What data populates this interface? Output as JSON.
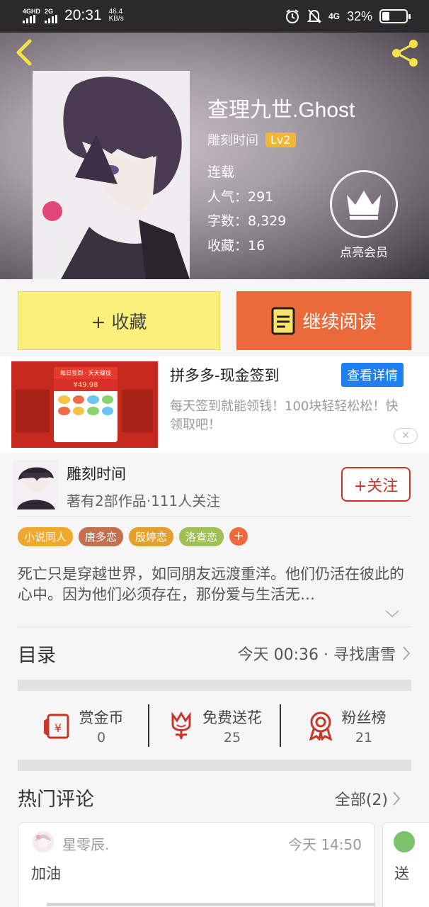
{
  "status_bar": {
    "net1": "4GHD",
    "net2": "2G",
    "time": "20:31",
    "speed_value": "46.4",
    "speed_unit": "KB/s",
    "net3": "4G",
    "battery_text": "32%",
    "battery_level": 0.32
  },
  "book": {
    "title": "查理九世.Ghost",
    "author": "雕刻时间",
    "level": "Lv2",
    "status": "连载",
    "popularity": "人气：291",
    "word_count": "字数：8,329",
    "favorites": "收藏：16"
  },
  "member": {
    "label": "点亮会员"
  },
  "actions": {
    "favorite": "+ 收藏",
    "continue_read": "继续阅读"
  },
  "ad": {
    "image_title": "每日签到 · 天天赚钱",
    "image_amount": "¥49.98",
    "title": "拼多多-现金签到",
    "cta": "查看详情",
    "description": "每天签到就能领钱！100块轻轻松松！快领取吧！",
    "close": "✕"
  },
  "author_card": {
    "name": "雕刻时间",
    "works": "著有2部作品·111人关注",
    "follow": "+关注"
  },
  "tags": [
    {
      "label": "小说同人",
      "color": "#f0a72d"
    },
    {
      "label": "唐多恋",
      "color": "#c4704f"
    },
    {
      "label": "殷婷恋",
      "color": "#e4a02f"
    },
    {
      "label": "洛查恋",
      "color": "#9fc053"
    }
  ],
  "tag_more": "+",
  "synopsis": "死亡只是穿越世界，如同朋友远渡重洋。他们仍活在彼此的心中。因为他们必须存在，那份爱与生活无…",
  "catalog": {
    "title": "目录",
    "latest": "今天 00:36 · 寻找唐雪"
  },
  "stats": [
    {
      "label": "赏金币",
      "value": "0"
    },
    {
      "label": "免费送花",
      "value": "25"
    },
    {
      "label": "粉丝榜",
      "value": "21"
    }
  ],
  "hot_comments": {
    "title": "热门评论",
    "all": "全部(2)",
    "items": [
      {
        "user": "星零辰.",
        "time": "今天 14:50",
        "text": "加油"
      },
      {
        "text": "送"
      }
    ]
  },
  "colors": {
    "accent": "#ec6a39",
    "favorite_bg": "#faf07b",
    "follow": "#c8362a",
    "level": "#f2b631",
    "ad_cta": "#1f7ef0"
  }
}
